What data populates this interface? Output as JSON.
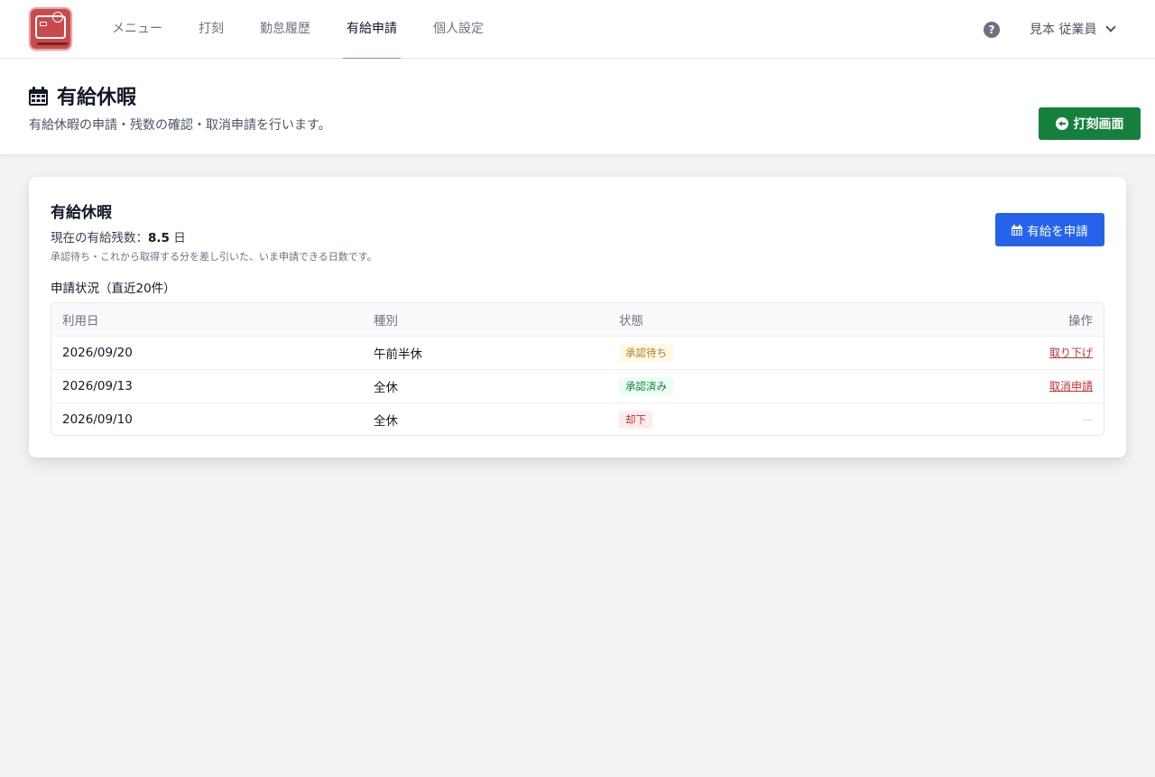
{
  "nav": {
    "items": [
      {
        "label": "メニュー"
      },
      {
        "label": "打刻"
      },
      {
        "label": "勤怠履歴"
      },
      {
        "label": "有給申請"
      },
      {
        "label": "個人設定"
      }
    ],
    "active_index": 3,
    "help_icon": "question-circle-icon",
    "user_name": "見本 従業員"
  },
  "header": {
    "title": "有給休暇",
    "description": "有給休暇の申請・残数の確認・取消申請を行います。",
    "punch_button": "打刻画面"
  },
  "card": {
    "title": "有給休暇",
    "balance_label": "現在の有給残数：",
    "balance_value": "8.5",
    "balance_unit": "日",
    "note": "承認待ち・これから取得する分を差し引いた、いま申請できる日数です。",
    "apply_button": "有給を申請",
    "status_heading": "申請状況（直近20件）",
    "table": {
      "headers": [
        "利用日",
        "種別",
        "状態",
        "操作"
      ],
      "rows": [
        {
          "date": "2026/09/20",
          "type": "午前半休",
          "status": "承認待ち",
          "status_kind": "pending",
          "action": "取り下げ"
        },
        {
          "date": "2026/09/13",
          "type": "全休",
          "status": "承認済み",
          "status_kind": "approved",
          "action": "取消申請"
        },
        {
          "date": "2026/09/10",
          "type": "全休",
          "status": "却下",
          "status_kind": "rejected",
          "action": "—"
        }
      ]
    }
  },
  "colors": {
    "primary": "#2563eb",
    "success": "#15803d",
    "nav_active_underline": "#7c8bd8",
    "logo": "#c94a4a"
  }
}
